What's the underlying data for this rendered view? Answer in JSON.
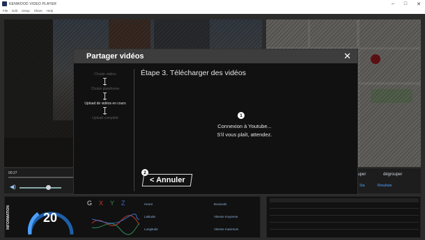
{
  "window": {
    "title": "KENWOOD VIDEO PLAYER",
    "controls": [
      "–",
      "□",
      "✕"
    ]
  },
  "menu": [
    "File",
    "Edit",
    "Setup",
    "Share",
    "Help"
  ],
  "player": {
    "time": "00:27"
  },
  "right_controls": {
    "group_label": "ouper",
    "ungroup_label": "dégrouper",
    "tabs": [
      "Sta",
      "Résultats"
    ]
  },
  "info": {
    "label": "INFORMATION",
    "speed": "20",
    "gsensor_axes": [
      "G",
      "X",
      "Y",
      "Z"
    ],
    "stats_left": [
      "Heure",
      "Latitude",
      "Longitude"
    ],
    "stats_right": [
      "Boussole",
      "Vitesse moyenne",
      "Vitesse maximum"
    ]
  },
  "modal": {
    "title": "Partager vidéos",
    "close_icon": "close-icon",
    "steps": [
      {
        "label": "Choisir vidéos",
        "active": false
      },
      {
        "label": "Choisir plateforme",
        "active": false
      },
      {
        "label": "Upload de vidéos en cours",
        "active": true
      },
      {
        "label": "Upload complété",
        "active": false
      }
    ],
    "step_heading": "Étape 3. Télécharger des vidéos",
    "badge_1": "1",
    "badge_2": "2",
    "message_line1": "Connexion à Youtube...",
    "message_line2": "S'il vous plaît, attendez.",
    "cancel_label": "< Annuler"
  },
  "colors": {
    "accent": "#4da0ff",
    "map_pin": "#d9262c"
  }
}
